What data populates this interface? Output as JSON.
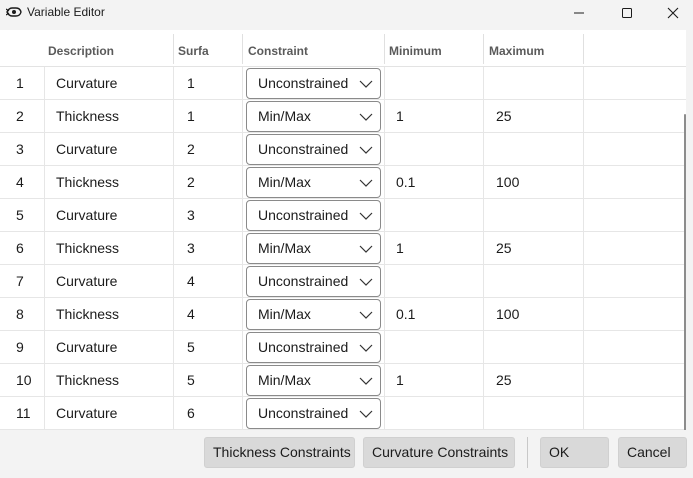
{
  "window": {
    "title": "Variable Editor"
  },
  "columns": {
    "description": "Description",
    "surface": "Surfa",
    "constraint": "Constraint",
    "minimum": "Minimum",
    "maximum": "Maximum"
  },
  "rows": [
    {
      "index": "1",
      "description": "Curvature",
      "surface": "1",
      "constraint": "Unconstrained",
      "minimum": "",
      "maximum": ""
    },
    {
      "index": "2",
      "description": "Thickness",
      "surface": "1",
      "constraint": "Min/Max",
      "minimum": "1",
      "maximum": "25"
    },
    {
      "index": "3",
      "description": "Curvature",
      "surface": "2",
      "constraint": "Unconstrained",
      "minimum": "",
      "maximum": ""
    },
    {
      "index": "4",
      "description": "Thickness",
      "surface": "2",
      "constraint": "Min/Max",
      "minimum": "0.1",
      "maximum": "100"
    },
    {
      "index": "5",
      "description": "Curvature",
      "surface": "3",
      "constraint": "Unconstrained",
      "minimum": "",
      "maximum": ""
    },
    {
      "index": "6",
      "description": "Thickness",
      "surface": "3",
      "constraint": "Min/Max",
      "minimum": "1",
      "maximum": "25"
    },
    {
      "index": "7",
      "description": "Curvature",
      "surface": "4",
      "constraint": "Unconstrained",
      "minimum": "",
      "maximum": ""
    },
    {
      "index": "8",
      "description": "Thickness",
      "surface": "4",
      "constraint": "Min/Max",
      "minimum": "0.1",
      "maximum": "100"
    },
    {
      "index": "9",
      "description": "Curvature",
      "surface": "5",
      "constraint": "Unconstrained",
      "minimum": "",
      "maximum": ""
    },
    {
      "index": "10",
      "description": "Thickness",
      "surface": "5",
      "constraint": "Min/Max",
      "minimum": "1",
      "maximum": "25"
    },
    {
      "index": "11",
      "description": "Curvature",
      "surface": "6",
      "constraint": "Unconstrained",
      "minimum": "",
      "maximum": ""
    }
  ],
  "buttons": {
    "thickness_constraints": "Thickness Constraints",
    "curvature_constraints": "Curvature Constraints",
    "ok": "OK",
    "cancel": "Cancel"
  },
  "icons": {
    "app": "variable-editor-app-icon",
    "minimize": "minimize-icon",
    "maximize": "maximize-icon",
    "close": "close-icon",
    "dropdown": "chevron-down-icon"
  }
}
